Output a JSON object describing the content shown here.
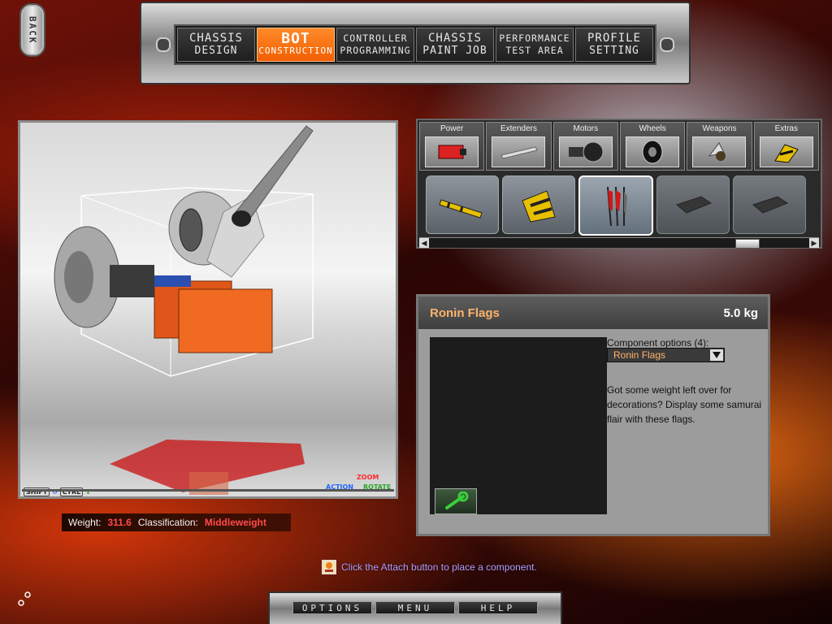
{
  "nav": {
    "back": "BACK",
    "tabs": [
      {
        "line1": "CHASSIS",
        "line2": "DESIGN",
        "active": false
      },
      {
        "line1": "BOT",
        "line2": "CONSTRUCTION",
        "active": true
      },
      {
        "line1": "CONTROLLER",
        "line2": "PROGRAMMING",
        "active": false
      },
      {
        "line1": "CHASSIS",
        "line2": "PAINT JOB",
        "active": false
      },
      {
        "line1": "PERFORMANCE",
        "line2": "TEST AREA",
        "active": false
      },
      {
        "line1": "PROFILE",
        "line2": "SETTING",
        "active": false
      }
    ]
  },
  "viewport": {
    "hints": {
      "shift": "SHIFT",
      "ctrl": "CTRL",
      "action": "ACTION",
      "zoom": "ZOOM",
      "rotate": "ROTATE"
    },
    "colors": {
      "action": "#2266ff",
      "zoom": "#ff2a2a",
      "rotate": "#2aa52a"
    }
  },
  "status": {
    "weight_label": "Weight:",
    "weight_value": "311.6",
    "class_label": "Classification:",
    "class_value": "Middleweight"
  },
  "parts": {
    "categories": [
      {
        "label": "Power",
        "icon": "battery-icon"
      },
      {
        "label": "Extenders",
        "icon": "extender-bar-icon"
      },
      {
        "label": "Motors",
        "icon": "motor-icon"
      },
      {
        "label": "Wheels",
        "icon": "wheel-icon"
      },
      {
        "label": "Weapons",
        "icon": "weapon-icon"
      },
      {
        "label": "Extras",
        "icon": "extras-icon"
      }
    ],
    "components": [
      {
        "icon": "striped-bar-icon",
        "selected": false
      },
      {
        "icon": "striped-flag-icon",
        "selected": false
      },
      {
        "icon": "ronin-flags-icon",
        "selected": true
      },
      {
        "icon": "block-icon",
        "selected": false
      },
      {
        "icon": "block-icon",
        "selected": false
      }
    ],
    "scroll_position": 0.86
  },
  "info": {
    "title": "Ronin Flags",
    "weight": "5.0 kg",
    "options_label": "Component options (4):",
    "selected_option": "Ronin Flags",
    "description": "Got some weight left over for decorations?  Display some samurai flair with these flags."
  },
  "tip": {
    "text": "Click the Attach button to place a component.",
    "icon": "tips-icon"
  },
  "bottom": {
    "options": "OPTIONS",
    "menu": "MENU",
    "help": "HELP"
  },
  "colors": {
    "accent": "#f25f00",
    "title": "#ffb36b",
    "warn": "#ff4a4a",
    "tip": "#b8a0ff"
  }
}
